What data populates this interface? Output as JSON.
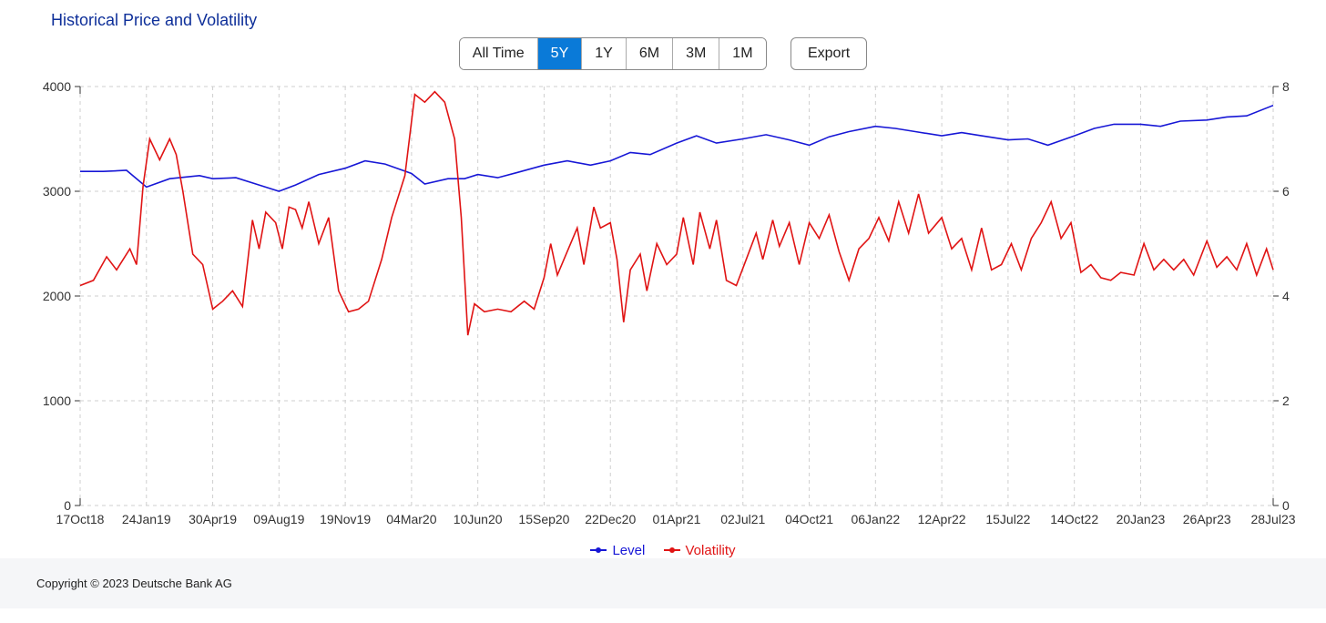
{
  "title": "Historical Price and Volatility",
  "controls": {
    "ranges": [
      "All Time",
      "5Y",
      "1Y",
      "6M",
      "3M",
      "1M"
    ],
    "active_index": 1,
    "export_label": "Export"
  },
  "legend": {
    "level": "Level",
    "volatility": "Volatility"
  },
  "footer": "Copyright © 2023 Deutsche Bank AG",
  "chart_data": {
    "type": "line",
    "title": "Historical Price and Volatility",
    "x_categories": [
      "17Oct18",
      "24Jan19",
      "30Apr19",
      "09Aug19",
      "19Nov19",
      "04Mar20",
      "10Jun20",
      "15Sep20",
      "22Dec20",
      "01Apr21",
      "02Jul21",
      "04Oct21",
      "06Jan22",
      "12Apr22",
      "15Jul22",
      "14Oct22",
      "20Jan23",
      "26Apr23",
      "28Jul23"
    ],
    "left_axis": {
      "label": "",
      "min": 0,
      "max": 4000,
      "ticks": [
        0,
        1000,
        2000,
        3000,
        4000
      ]
    },
    "right_axis": {
      "label": "",
      "min": 0,
      "max": 8,
      "ticks": [
        0,
        2,
        4,
        6,
        8
      ]
    },
    "series": [
      {
        "name": "Level",
        "axis": "left",
        "color": "#1717d6",
        "points": [
          [
            0.0,
            3190
          ],
          [
            0.35,
            3190
          ],
          [
            0.7,
            3200
          ],
          [
            1.0,
            3040
          ],
          [
            1.35,
            3120
          ],
          [
            1.8,
            3150
          ],
          [
            2.0,
            3120
          ],
          [
            2.35,
            3130
          ],
          [
            2.7,
            3060
          ],
          [
            3.0,
            3000
          ],
          [
            3.25,
            3060
          ],
          [
            3.6,
            3160
          ],
          [
            4.0,
            3220
          ],
          [
            4.3,
            3290
          ],
          [
            4.6,
            3260
          ],
          [
            5.0,
            3170
          ],
          [
            5.2,
            3070
          ],
          [
            5.55,
            3120
          ],
          [
            5.8,
            3120
          ],
          [
            6.0,
            3160
          ],
          [
            6.3,
            3130
          ],
          [
            6.6,
            3180
          ],
          [
            7.0,
            3250
          ],
          [
            7.35,
            3290
          ],
          [
            7.7,
            3250
          ],
          [
            8.0,
            3290
          ],
          [
            8.3,
            3370
          ],
          [
            8.6,
            3350
          ],
          [
            9.0,
            3460
          ],
          [
            9.3,
            3530
          ],
          [
            9.6,
            3460
          ],
          [
            10.0,
            3500
          ],
          [
            10.35,
            3540
          ],
          [
            10.7,
            3490
          ],
          [
            11.0,
            3440
          ],
          [
            11.3,
            3520
          ],
          [
            11.6,
            3570
          ],
          [
            12.0,
            3620
          ],
          [
            12.3,
            3600
          ],
          [
            12.6,
            3570
          ],
          [
            13.0,
            3530
          ],
          [
            13.3,
            3560
          ],
          [
            13.6,
            3530
          ],
          [
            14.0,
            3490
          ],
          [
            14.3,
            3500
          ],
          [
            14.6,
            3440
          ],
          [
            15.0,
            3530
          ],
          [
            15.3,
            3600
          ],
          [
            15.6,
            3640
          ],
          [
            16.0,
            3640
          ],
          [
            16.3,
            3620
          ],
          [
            16.6,
            3670
          ],
          [
            17.0,
            3680
          ],
          [
            17.3,
            3710
          ],
          [
            17.6,
            3720
          ],
          [
            18.0,
            3820
          ]
        ]
      },
      {
        "name": "Volatility",
        "axis": "right",
        "color": "#e01414",
        "points": [
          [
            0.0,
            4.2
          ],
          [
            0.2,
            4.3
          ],
          [
            0.4,
            4.75
          ],
          [
            0.55,
            4.5
          ],
          [
            0.75,
            4.9
          ],
          [
            0.85,
            4.6
          ],
          [
            0.95,
            6.1
          ],
          [
            1.05,
            7.0
          ],
          [
            1.2,
            6.6
          ],
          [
            1.35,
            7.0
          ],
          [
            1.45,
            6.7
          ],
          [
            1.55,
            6.0
          ],
          [
            1.7,
            4.8
          ],
          [
            1.85,
            4.6
          ],
          [
            2.0,
            3.75
          ],
          [
            2.15,
            3.9
          ],
          [
            2.3,
            4.1
          ],
          [
            2.45,
            3.8
          ],
          [
            2.6,
            5.45
          ],
          [
            2.7,
            4.9
          ],
          [
            2.8,
            5.6
          ],
          [
            2.95,
            5.4
          ],
          [
            3.05,
            4.9
          ],
          [
            3.15,
            5.7
          ],
          [
            3.25,
            5.65
          ],
          [
            3.35,
            5.3
          ],
          [
            3.45,
            5.8
          ],
          [
            3.6,
            5.0
          ],
          [
            3.75,
            5.5
          ],
          [
            3.9,
            4.1
          ],
          [
            4.05,
            3.7
          ],
          [
            4.2,
            3.75
          ],
          [
            4.35,
            3.9
          ],
          [
            4.55,
            4.7
          ],
          [
            4.7,
            5.5
          ],
          [
            4.9,
            6.3
          ],
          [
            5.05,
            7.85
          ],
          [
            5.2,
            7.7
          ],
          [
            5.35,
            7.9
          ],
          [
            5.5,
            7.7
          ],
          [
            5.65,
            7.0
          ],
          [
            5.75,
            5.5
          ],
          [
            5.85,
            3.25
          ],
          [
            5.95,
            3.85
          ],
          [
            6.1,
            3.7
          ],
          [
            6.3,
            3.75
          ],
          [
            6.5,
            3.7
          ],
          [
            6.7,
            3.9
          ],
          [
            6.85,
            3.75
          ],
          [
            7.0,
            4.35
          ],
          [
            7.1,
            5.0
          ],
          [
            7.2,
            4.4
          ],
          [
            7.35,
            4.85
          ],
          [
            7.5,
            5.3
          ],
          [
            7.6,
            4.6
          ],
          [
            7.75,
            5.7
          ],
          [
            7.85,
            5.3
          ],
          [
            8.0,
            5.4
          ],
          [
            8.1,
            4.7
          ],
          [
            8.2,
            3.5
          ],
          [
            8.3,
            4.5
          ],
          [
            8.45,
            4.8
          ],
          [
            8.55,
            4.1
          ],
          [
            8.7,
            5.0
          ],
          [
            8.85,
            4.6
          ],
          [
            9.0,
            4.8
          ],
          [
            9.1,
            5.5
          ],
          [
            9.25,
            4.6
          ],
          [
            9.35,
            5.6
          ],
          [
            9.5,
            4.9
          ],
          [
            9.6,
            5.45
          ],
          [
            9.75,
            4.3
          ],
          [
            9.9,
            4.2
          ],
          [
            10.05,
            4.7
          ],
          [
            10.2,
            5.2
          ],
          [
            10.3,
            4.7
          ],
          [
            10.45,
            5.45
          ],
          [
            10.55,
            4.95
          ],
          [
            10.7,
            5.4
          ],
          [
            10.85,
            4.6
          ],
          [
            11.0,
            5.4
          ],
          [
            11.15,
            5.1
          ],
          [
            11.3,
            5.55
          ],
          [
            11.45,
            4.85
          ],
          [
            11.6,
            4.3
          ],
          [
            11.75,
            4.9
          ],
          [
            11.9,
            5.1
          ],
          [
            12.05,
            5.5
          ],
          [
            12.2,
            5.05
          ],
          [
            12.35,
            5.8
          ],
          [
            12.5,
            5.2
          ],
          [
            12.65,
            5.95
          ],
          [
            12.8,
            5.2
          ],
          [
            13.0,
            5.5
          ],
          [
            13.15,
            4.9
          ],
          [
            13.3,
            5.1
          ],
          [
            13.45,
            4.5
          ],
          [
            13.6,
            5.3
          ],
          [
            13.75,
            4.5
          ],
          [
            13.9,
            4.6
          ],
          [
            14.05,
            5.0
          ],
          [
            14.2,
            4.5
          ],
          [
            14.35,
            5.1
          ],
          [
            14.5,
            5.4
          ],
          [
            14.65,
            5.8
          ],
          [
            14.8,
            5.1
          ],
          [
            14.95,
            5.4
          ],
          [
            15.1,
            4.45
          ],
          [
            15.25,
            4.6
          ],
          [
            15.4,
            4.35
          ],
          [
            15.55,
            4.3
          ],
          [
            15.7,
            4.45
          ],
          [
            15.9,
            4.4
          ],
          [
            16.05,
            5.0
          ],
          [
            16.2,
            4.5
          ],
          [
            16.35,
            4.7
          ],
          [
            16.5,
            4.5
          ],
          [
            16.65,
            4.7
          ],
          [
            16.8,
            4.4
          ],
          [
            17.0,
            5.05
          ],
          [
            17.15,
            4.55
          ],
          [
            17.3,
            4.75
          ],
          [
            17.45,
            4.5
          ],
          [
            17.6,
            5.0
          ],
          [
            17.75,
            4.4
          ],
          [
            17.9,
            4.9
          ],
          [
            18.0,
            4.5
          ]
        ]
      }
    ]
  }
}
